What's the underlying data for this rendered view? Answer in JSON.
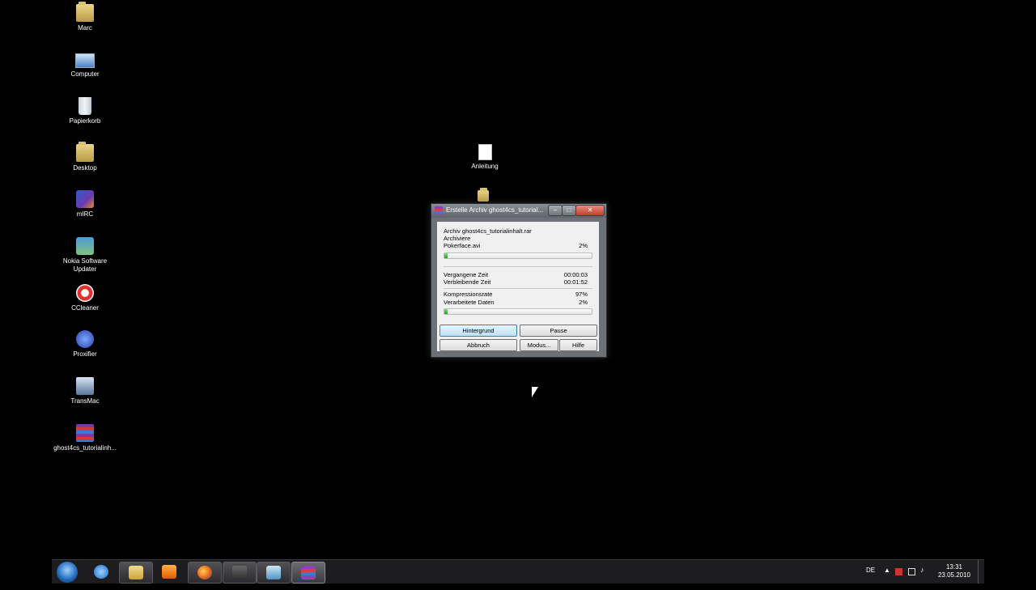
{
  "desktop": {
    "icons": [
      {
        "label": "Marc",
        "icon": "user-folder-icon"
      },
      {
        "label": "Computer",
        "icon": "computer-icon"
      },
      {
        "label": "Papierkorb",
        "icon": "recycle-bin-icon"
      },
      {
        "label": "Desktop",
        "icon": "folder-icon"
      },
      {
        "label": "mIRC",
        "icon": "mirc-icon"
      },
      {
        "label": "Nokia Software Updater",
        "icon": "nokia-icon"
      },
      {
        "label": "CCleaner",
        "icon": "ccleaner-icon"
      },
      {
        "label": "Proxifier",
        "icon": "proxifier-icon"
      },
      {
        "label": "TransMac",
        "icon": "transmac-icon"
      },
      {
        "label": "ghost4cs_tutorialinh...",
        "icon": "rar-archive-icon"
      },
      {
        "label": "Anleitung",
        "icon": "document-icon"
      }
    ]
  },
  "dialog": {
    "title": "Erstelle Archiv ghost4cs_tutorial...",
    "archive_line": "Archiv ghost4cs_tutorialinhalt.rar",
    "action": "Archiviere",
    "file_name": "Pokerface.avi",
    "file_percent": "2%",
    "file_progress": 0.02,
    "elapsed_label": "Vergangene Zeit",
    "elapsed_value": "00:00:03",
    "remaining_label": "Verbleibende Zeit",
    "remaining_value": "00:01:52",
    "ratio_label": "Kompressionsrate",
    "ratio_value": "97%",
    "processed_label": "Verarbeitete Daten",
    "processed_value": "2%",
    "total_progress": 0.02,
    "buttons": {
      "background": "Hintergrund",
      "pause": "Pause",
      "cancel": "Abbruch",
      "mode": "Modus...",
      "help": "Hilfe"
    }
  },
  "taskbar": {
    "apps": [
      "start-orb-icon",
      "internet-explorer-icon",
      "explorer-icon",
      "media-player-icon",
      "firefox-icon",
      "app-icon",
      "app-icon",
      "winrar-icon"
    ],
    "language": "DE",
    "time": "13:31",
    "date": "23.05.2010"
  }
}
